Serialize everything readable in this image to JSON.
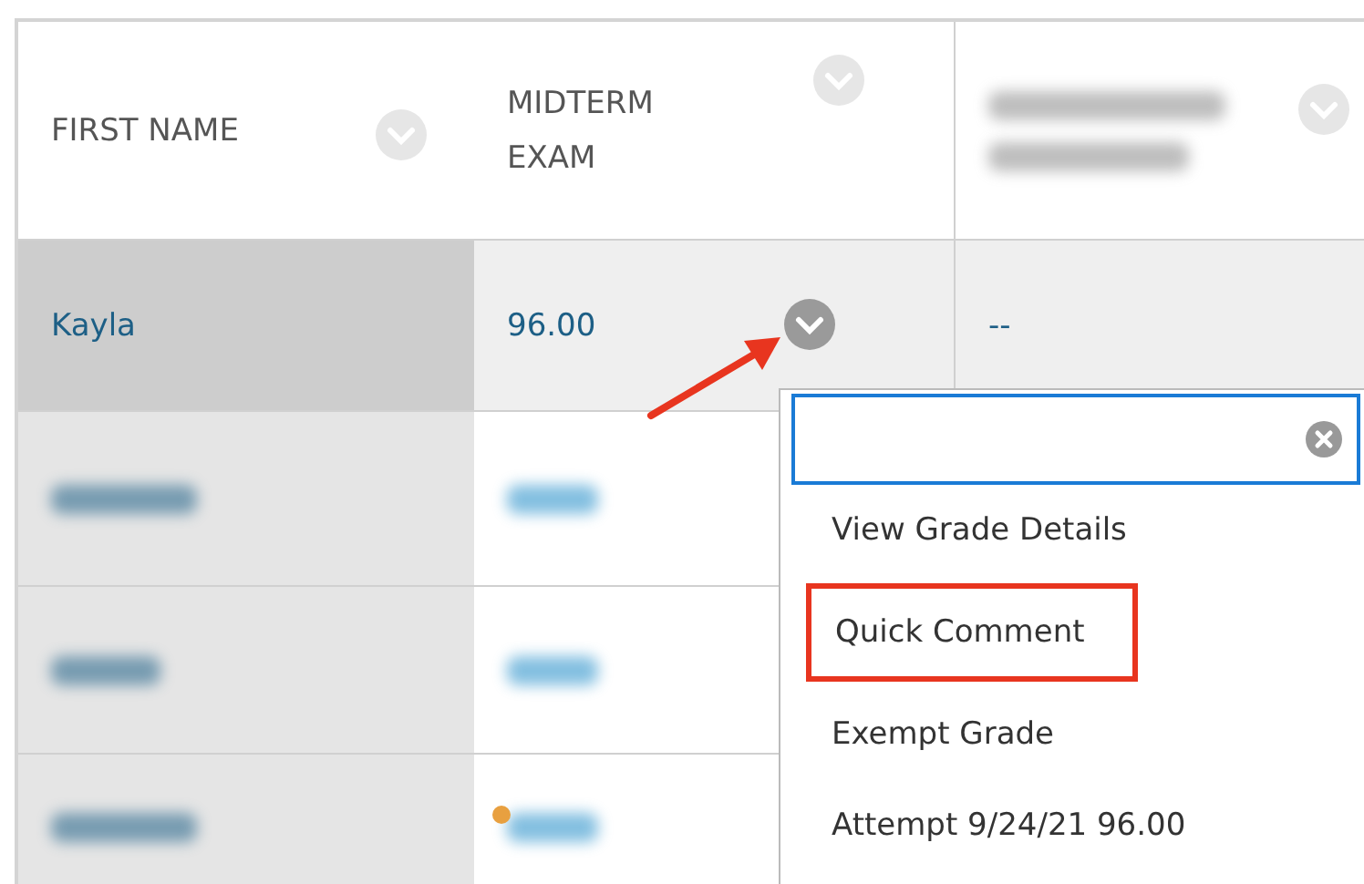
{
  "table": {
    "columns": [
      {
        "kind": "text",
        "heading": "FIRST NAME"
      },
      {
        "kind": "text",
        "heading": "MIDTERM EXAM"
      },
      {
        "kind": "blurred"
      }
    ],
    "rows": [
      {
        "kind": "text",
        "selected": true,
        "name": "Kayla",
        "grade": "96.00",
        "column_3": "--"
      },
      {
        "kind": "blurred",
        "selected": false,
        "flagged": false
      },
      {
        "kind": "blurred",
        "selected": false,
        "flagged": false
      },
      {
        "kind": "blurred",
        "selected": false,
        "flagged": true
      }
    ]
  },
  "menu": {
    "items": [
      {
        "label": "View Grade Details",
        "highlighted": false
      },
      {
        "label": "Quick Comment",
        "highlighted": true
      },
      {
        "label": "Exempt Grade",
        "highlighted": false
      },
      {
        "label": "Attempt 9/24/21 96.00",
        "highlighted": false
      }
    ]
  }
}
